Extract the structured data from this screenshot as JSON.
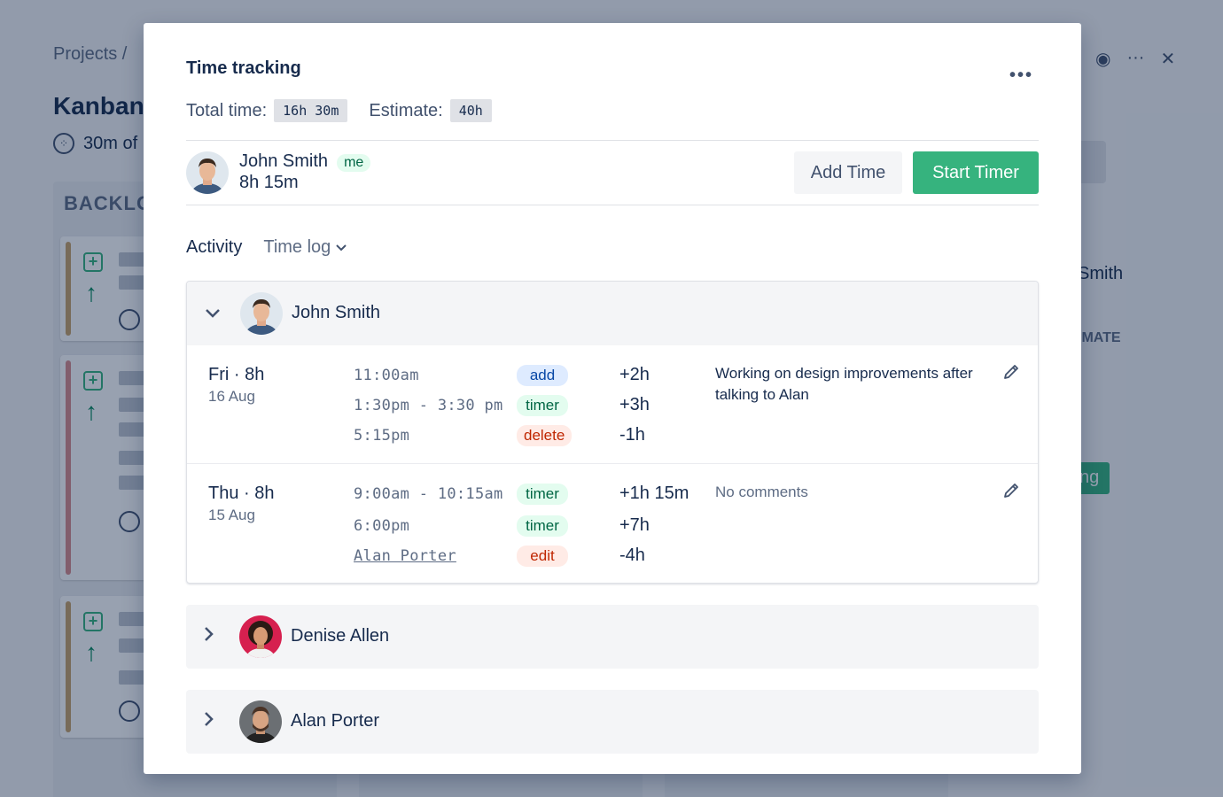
{
  "background": {
    "breadcrumb": "Projects  /",
    "page_title": "Kanban b",
    "time_line": "30m of",
    "column_header": "BACKLO",
    "right_name": "Smith",
    "right_label": "IMATE",
    "right_button": "ng"
  },
  "modal": {
    "title": "Time tracking",
    "total_label": "Total time:",
    "total_value": "16h 30m",
    "estimate_label": "Estimate:",
    "estimate_value": "40h",
    "current_user": {
      "name": "John Smith",
      "badge": "me",
      "time": "8h 15m"
    },
    "add_time_label": "Add Time",
    "start_timer_label": "Start Timer",
    "tabs": {
      "activity": "Activity",
      "time_log": "Time log"
    },
    "groups": [
      {
        "name": "John Smith",
        "expanded": true,
        "days": [
          {
            "label": "Fri · 8h",
            "date": "16 Aug",
            "entries": [
              {
                "time": "11:00am",
                "type": "add",
                "delta": "+2h"
              },
              {
                "time": "1:30pm - 3:30 pm",
                "type": "timer",
                "delta": "+3h"
              },
              {
                "time": "5:15pm",
                "type": "delete",
                "delta": "-1h"
              }
            ],
            "comment": "Working on design improvements after talking to Alan"
          },
          {
            "label": "Thu · 8h",
            "date": "15 Aug",
            "entries": [
              {
                "time": "9:00am - 10:15am",
                "type": "timer",
                "delta": "+1h 15m"
              },
              {
                "time": "6:00pm",
                "type": "timer",
                "delta": "+7h"
              },
              {
                "time": "Alan Porter",
                "type": "edit",
                "delta": "-4h"
              }
            ],
            "comment": "No comments"
          }
        ]
      },
      {
        "name": "Denise Allen",
        "expanded": false
      },
      {
        "name": "Alan Porter",
        "expanded": false
      }
    ]
  },
  "colors": {
    "accent_green": "#36b37e",
    "text_primary": "#172b4d",
    "text_muted": "#5e6c84"
  }
}
